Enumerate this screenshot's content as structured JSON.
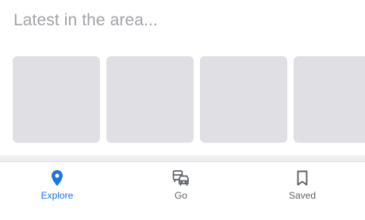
{
  "section": {
    "title": "Latest in the area..."
  },
  "cards": [
    {
      "placeholder": true
    },
    {
      "placeholder": true
    },
    {
      "placeholder": true
    },
    {
      "placeholder": true
    }
  ],
  "tabbar": {
    "active": "explore",
    "accent_color": "#1a73e8",
    "inactive_color": "#5f6368",
    "tabs": [
      {
        "id": "explore",
        "label": "Explore",
        "icon": "location-pin-icon"
      },
      {
        "id": "go",
        "label": "Go",
        "icon": "commute-icon"
      },
      {
        "id": "saved",
        "label": "Saved",
        "icon": "bookmark-icon"
      }
    ]
  }
}
